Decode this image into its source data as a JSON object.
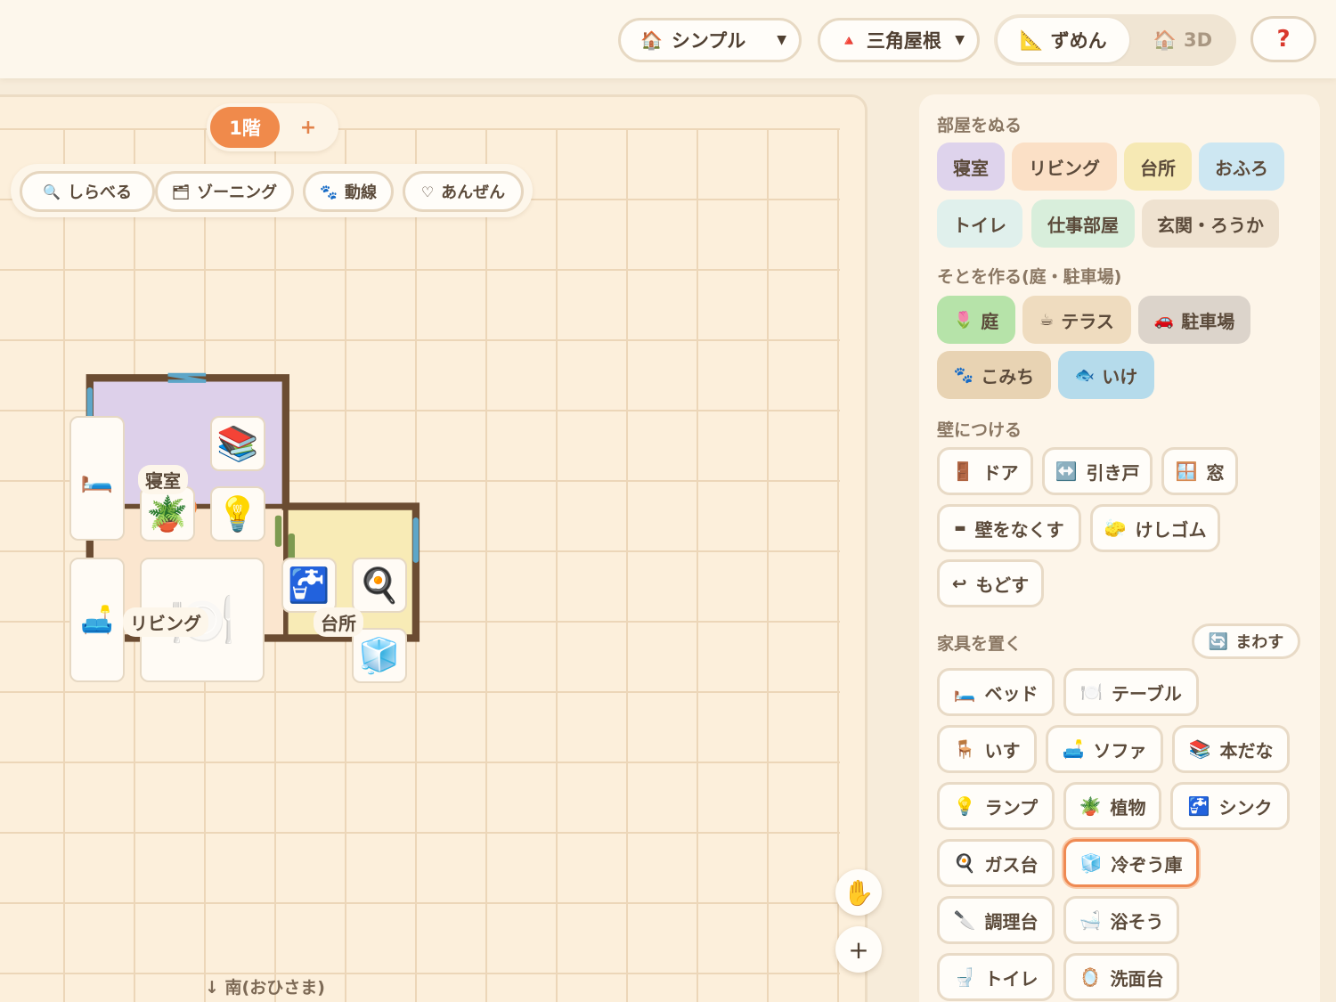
{
  "topbar": {
    "style_select": {
      "icon": "🏠",
      "value": "シンプル"
    },
    "roof_select": {
      "icon": "🔺",
      "value": "三角屋根"
    },
    "view": {
      "plan_icon": "📐",
      "plan_label": "ずめん",
      "threed_icon": "🏠",
      "threed_label": "3D"
    },
    "help_label": "?"
  },
  "floors": {
    "active": "1階",
    "add": "+"
  },
  "tools": [
    {
      "icon": "🔍",
      "label": "しらべる"
    },
    {
      "icon": "🗂",
      "label": "ゾーニング"
    },
    {
      "icon": "🐾",
      "label": "動線"
    },
    {
      "icon": "♡",
      "label": "あんぜん"
    }
  ],
  "plan": {
    "rooms": [
      {
        "label": "寝室",
        "color": "#ddd0ea"
      },
      {
        "label": "リビング",
        "color": "#fbe6cf"
      },
      {
        "label": "台所",
        "color": "#f8ebb6"
      }
    ],
    "furniture": [
      {
        "icon": "🛏️"
      },
      {
        "icon": "📚"
      },
      {
        "icon": "🪴"
      },
      {
        "icon": "💡"
      },
      {
        "icon": "🛋️"
      },
      {
        "icon": "🍽️"
      },
      {
        "icon": "🚰"
      },
      {
        "icon": "🍳"
      },
      {
        "icon": "🧊"
      }
    ],
    "compass": "↓ 南(おひさま)"
  },
  "canvas_controls": {
    "pan": "✋",
    "zoom_in": "+"
  },
  "panel": {
    "rooms_title": "部屋をぬる",
    "rooms": [
      {
        "label": "寝室",
        "color": "#ded3ec"
      },
      {
        "label": "リビング",
        "color": "#fbe0c6"
      },
      {
        "label": "台所",
        "color": "#f6e9b4"
      },
      {
        "label": "おふろ",
        "color": "#cde7f2"
      },
      {
        "label": "トイレ",
        "color": "#e0f0ec"
      },
      {
        "label": "仕事部屋",
        "color": "#d8eedb"
      },
      {
        "label": "玄関・ろうか",
        "color": "#efe2d0"
      }
    ],
    "outside_title": "そとを作る(庭・駐車場)",
    "outside": [
      {
        "icon": "🌷",
        "label": "庭",
        "color": "#b6e3a9"
      },
      {
        "icon": "☕",
        "label": "テラス",
        "color": "#efdcbf"
      },
      {
        "icon": "🚗",
        "label": "駐車場",
        "color": "#dcd4cb"
      },
      {
        "icon": "🐾",
        "label": "こみち",
        "color": "#e8d3b3"
      },
      {
        "icon": "🐟",
        "label": "いけ",
        "color": "#b5dbeb"
      }
    ],
    "walls_title": "壁につける",
    "walls": [
      {
        "icon": "🚪",
        "label": "ドア"
      },
      {
        "icon": "↔️",
        "label": "引き戸"
      },
      {
        "icon": "🪟",
        "label": "窓"
      },
      {
        "icon": "▬",
        "label": "壁をなくす"
      },
      {
        "icon": "🧽",
        "label": "けしゴム"
      },
      {
        "icon": "↩",
        "label": "もどす"
      }
    ],
    "furniture_title": "家具を置く",
    "rotate": {
      "icon": "🔄",
      "label": "まわす"
    },
    "furniture": [
      {
        "icon": "🛏️",
        "label": "ベッド"
      },
      {
        "icon": "🍽️",
        "label": "テーブル"
      },
      {
        "icon": "🪑",
        "label": "いす"
      },
      {
        "icon": "🛋️",
        "label": "ソファ"
      },
      {
        "icon": "📚",
        "label": "本だな"
      },
      {
        "icon": "💡",
        "label": "ランプ"
      },
      {
        "icon": "🪴",
        "label": "植物"
      },
      {
        "icon": "🚰",
        "label": "シンク"
      },
      {
        "icon": "🍳",
        "label": "ガス台"
      },
      {
        "icon": "🧊",
        "label": "冷ぞう庫"
      },
      {
        "icon": "🔪",
        "label": "調理台"
      },
      {
        "icon": "🛁",
        "label": "浴そう"
      },
      {
        "icon": "🚽",
        "label": "トイレ"
      },
      {
        "icon": "🪞",
        "label": "洗面台"
      }
    ],
    "selected_furniture": "冷ぞう庫"
  }
}
